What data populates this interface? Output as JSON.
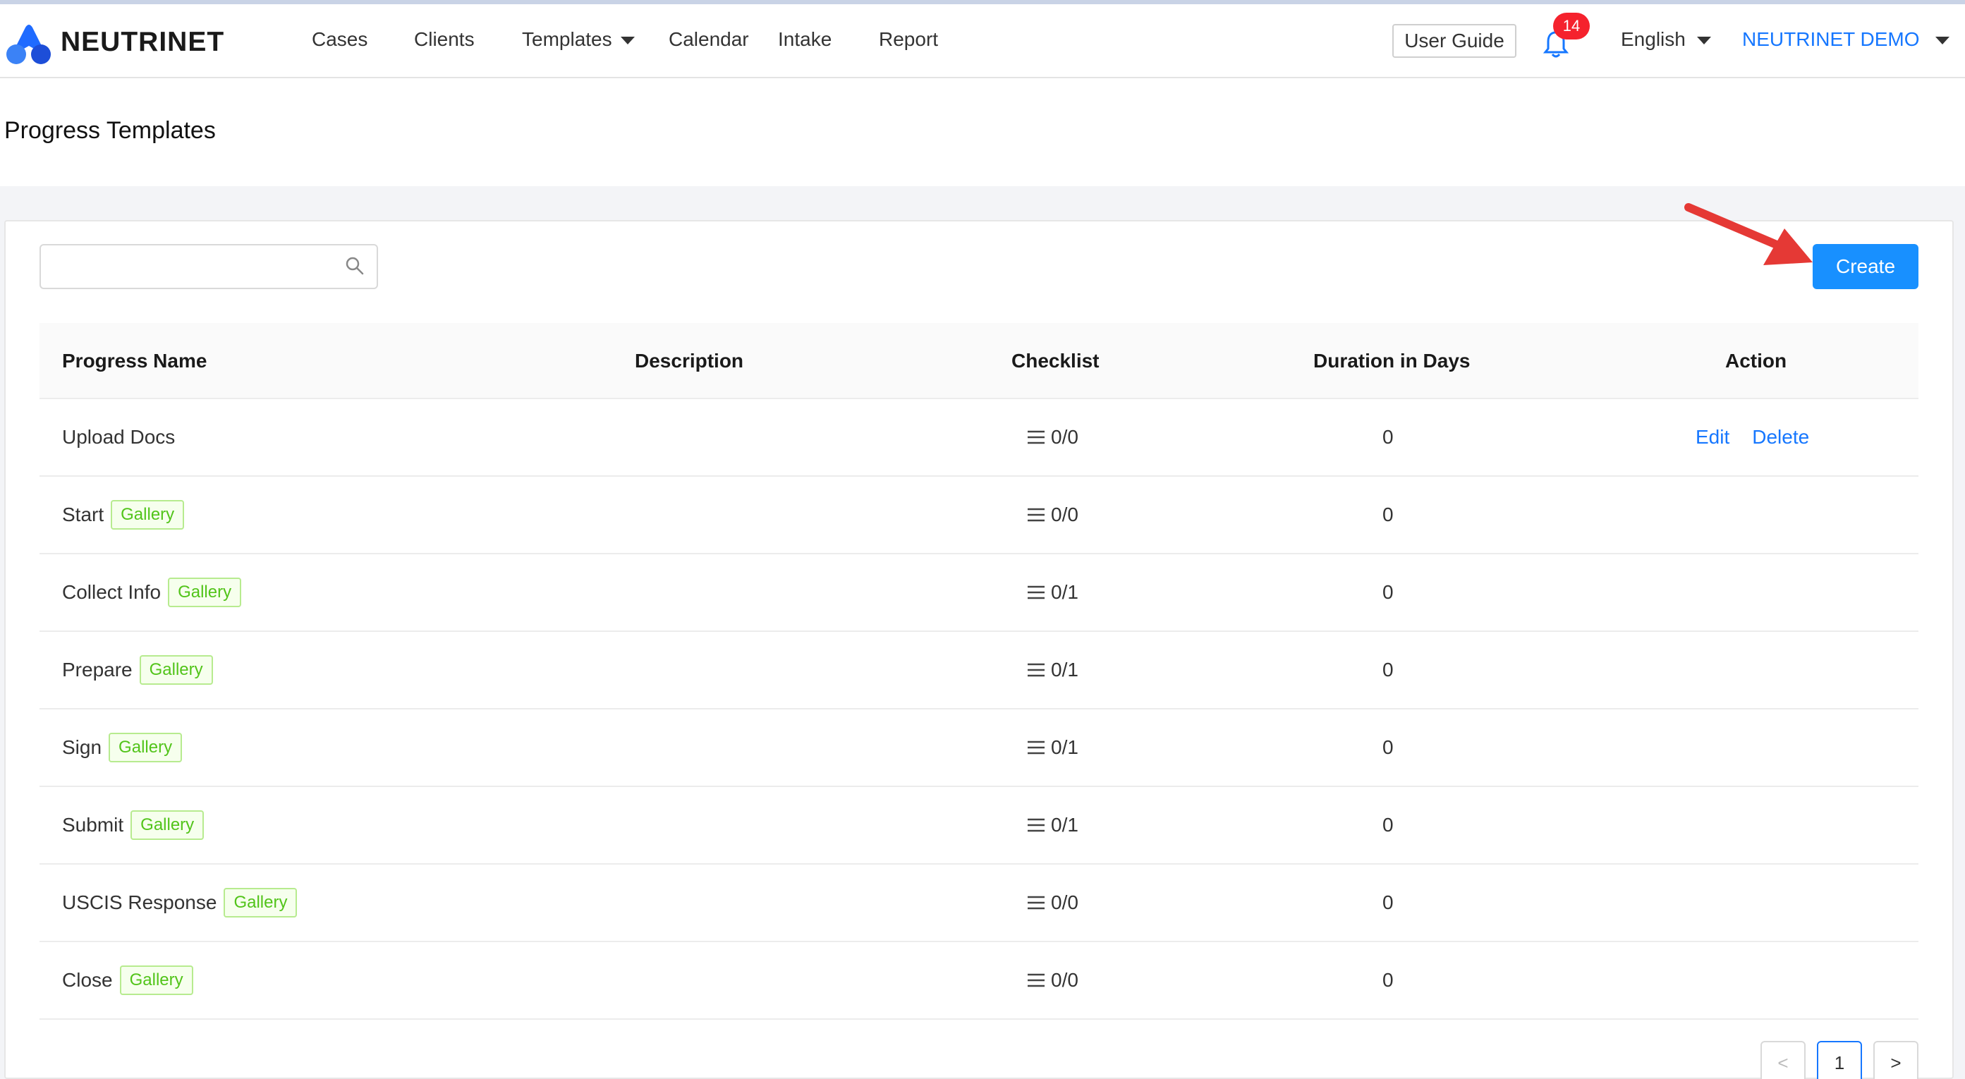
{
  "brand": {
    "name": "NEUTRINET"
  },
  "nav": {
    "cases": "Cases",
    "clients": "Clients",
    "templates": "Templates",
    "calendar": "Calendar",
    "intake": "Intake",
    "report": "Report"
  },
  "header": {
    "user_guide": "User Guide",
    "notification_count": "14",
    "language": "English",
    "user": "NEUTRINET DEMO"
  },
  "page": {
    "title": "Progress Templates"
  },
  "search": {
    "value": "",
    "placeholder": ""
  },
  "toolbar": {
    "create_label": "Create"
  },
  "table": {
    "columns": [
      "Progress Name",
      "Description",
      "Checklist",
      "Duration in Days",
      "Action"
    ],
    "rows": [
      {
        "name": "Upload Docs",
        "tag": "",
        "description": "",
        "checklist": "0/0",
        "duration": "0",
        "edit": "Edit",
        "delete": "Delete"
      },
      {
        "name": "Start",
        "tag": "Gallery",
        "description": "",
        "checklist": "0/0",
        "duration": "0"
      },
      {
        "name": "Collect Info",
        "tag": "Gallery",
        "description": "",
        "checklist": "0/1",
        "duration": "0"
      },
      {
        "name": "Prepare",
        "tag": "Gallery",
        "description": "",
        "checklist": "0/1",
        "duration": "0"
      },
      {
        "name": "Sign",
        "tag": "Gallery",
        "description": "",
        "checklist": "0/1",
        "duration": "0"
      },
      {
        "name": "Submit",
        "tag": "Gallery",
        "description": "",
        "checklist": "0/1",
        "duration": "0"
      },
      {
        "name": "USCIS Response",
        "tag": "Gallery",
        "description": "",
        "checklist": "0/0",
        "duration": "0"
      },
      {
        "name": "Close",
        "tag": "Gallery",
        "description": "",
        "checklist": "0/0",
        "duration": "0"
      }
    ]
  },
  "pagination": {
    "prev": "<",
    "current": "1",
    "next": ">"
  },
  "colors": {
    "primary": "#1890ff",
    "link": "#1677ff",
    "tag_green": "#52c41a",
    "badge_red": "#f5222d",
    "arrow_red": "#e53935"
  }
}
